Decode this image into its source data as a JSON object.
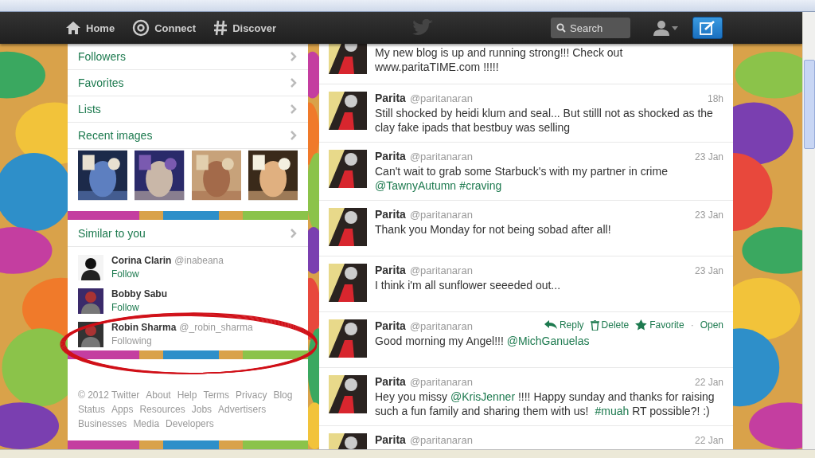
{
  "nav": {
    "items": [
      {
        "label": "Home",
        "kind": "home"
      },
      {
        "label": "Connect",
        "kind": "connect"
      },
      {
        "label": "Discover",
        "kind": "discover"
      }
    ],
    "search": {
      "placeholder": "Search"
    }
  },
  "sidebar": {
    "items": [
      {
        "label": "Followers"
      },
      {
        "label": "Favorites"
      },
      {
        "label": "Lists"
      },
      {
        "label": "Recent images"
      }
    ],
    "similar": {
      "title": "Similar to you",
      "people": [
        {
          "name": "Corina Clarin",
          "handle": "@inabeana",
          "action": "Follow",
          "following": false
        },
        {
          "name": "Bobby Sabu",
          "action": "Follow",
          "following": false
        },
        {
          "name": "Robin Sharma",
          "handle": "@_robin_sharma",
          "action": "Following",
          "following": true
        }
      ]
    },
    "footer_links": [
      "© 2012 Twitter",
      "About",
      "Help",
      "Terms",
      "Privacy",
      "Blog",
      "Status",
      "Apps",
      "Resources",
      "Jobs",
      "Advertisers",
      "Businesses",
      "Media",
      "Developers"
    ]
  },
  "tweets": [
    {
      "parts": [
        {
          "kind": "plain",
          "text": "My new blog is up and running strong!!! Check out www.paritaTIME.com !!!!!"
        }
      ]
    },
    {
      "name": "Parita",
      "handle": "@paritanaran",
      "time": "18h",
      "parts": [
        {
          "kind": "plain",
          "text": "Still shocked by heidi klum and seal... But stilll not as shocked as the clay fake ipads that bestbuy was selling"
        }
      ]
    },
    {
      "name": "Parita",
      "handle": "@paritanaran",
      "time": "23 Jan",
      "parts": [
        {
          "kind": "plain",
          "text": "Can't wait to grab some Starbuck's with my partner in crime "
        },
        {
          "kind": "link",
          "text": "@TawnyAutumn"
        },
        {
          "kind": "link",
          "text": "#craving"
        }
      ]
    },
    {
      "name": "Parita",
      "handle": "@paritanaran",
      "time": "23 Jan",
      "parts": [
        {
          "kind": "plain",
          "text": "Thank you Monday for not being sobad after all!"
        }
      ]
    },
    {
      "name": "Parita",
      "handle": "@paritanaran",
      "time": "23 Jan",
      "parts": [
        {
          "kind": "plain",
          "text": "I think i'm all sunflower seeeded out..."
        }
      ]
    },
    {
      "name": "Parita",
      "handle": "@paritanaran",
      "actions": [
        {
          "kind": "reply",
          "label": "Reply"
        },
        {
          "kind": "delete",
          "label": "Delete"
        },
        {
          "kind": "favorite",
          "label": "Favorite"
        },
        {
          "kind": "separator",
          "label": "·"
        },
        {
          "kind": "open",
          "label": "Open"
        }
      ],
      "parts": [
        {
          "kind": "plain",
          "text": "Good morning my Angel!!! "
        },
        {
          "kind": "link",
          "text": "@MichGanuelas"
        }
      ]
    },
    {
      "name": "Parita",
      "handle": "@paritanaran",
      "time": "22 Jan",
      "parts": [
        {
          "kind": "plain",
          "text": "Hey you missy "
        },
        {
          "kind": "link",
          "text": "@KrisJenner"
        },
        {
          "kind": "plain",
          "text": " !!!! Happy sunday and thanks for raising such a fun family and sharing them with us! "
        },
        {
          "kind": "link",
          "text": "#muah"
        },
        {
          "kind": "plain",
          "text": " RT possible?! :)"
        }
      ]
    },
    {
      "name": "Parita",
      "handle": "@paritanaran",
      "time": "22 Jan"
    }
  ]
}
